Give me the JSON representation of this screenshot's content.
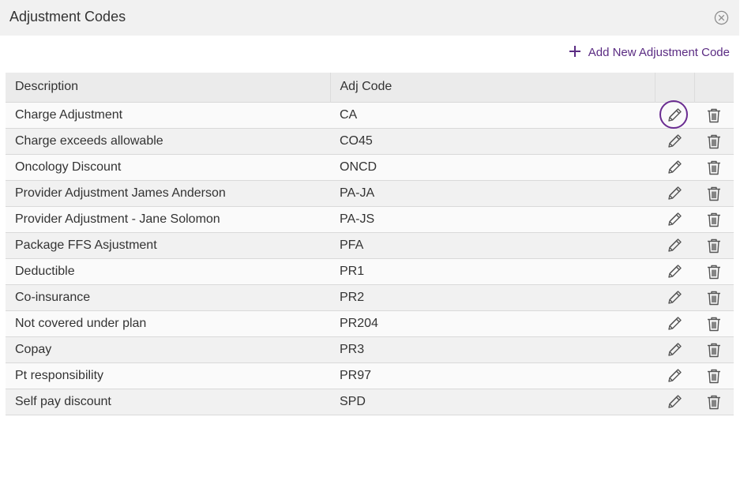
{
  "dialog": {
    "title": "Adjustment Codes",
    "close_icon": "close-circle-icon"
  },
  "toolbar": {
    "add_label": "Add New Adjustment Code",
    "add_icon": "plus-icon",
    "accent_color": "#5b2c83"
  },
  "table": {
    "columns": [
      "Description",
      "Adj Code",
      "",
      ""
    ],
    "rows": [
      {
        "description": "Charge Adjustment",
        "code": "CA"
      },
      {
        "description": "Charge exceeds allowable",
        "code": "CO45"
      },
      {
        "description": "Oncology Discount",
        "code": "ONCD"
      },
      {
        "description": "Provider Adjustment James Anderson",
        "code": "PA-JA"
      },
      {
        "description": "Provider Adjustment - Jane Solomon",
        "code": "PA-JS"
      },
      {
        "description": "Package FFS Asjustment",
        "code": "PFA"
      },
      {
        "description": "Deductible",
        "code": "PR1"
      },
      {
        "description": "Co-insurance",
        "code": "PR2"
      },
      {
        "description": "Not covered under plan",
        "code": "PR204"
      },
      {
        "description": "Copay",
        "code": "PR3"
      },
      {
        "description": "Pt responsibility",
        "code": "PR97"
      },
      {
        "description": "Self pay discount",
        "code": "SPD"
      }
    ],
    "row_actions": [
      "pencil-icon",
      "trash-icon"
    ],
    "focused_row": 0
  }
}
